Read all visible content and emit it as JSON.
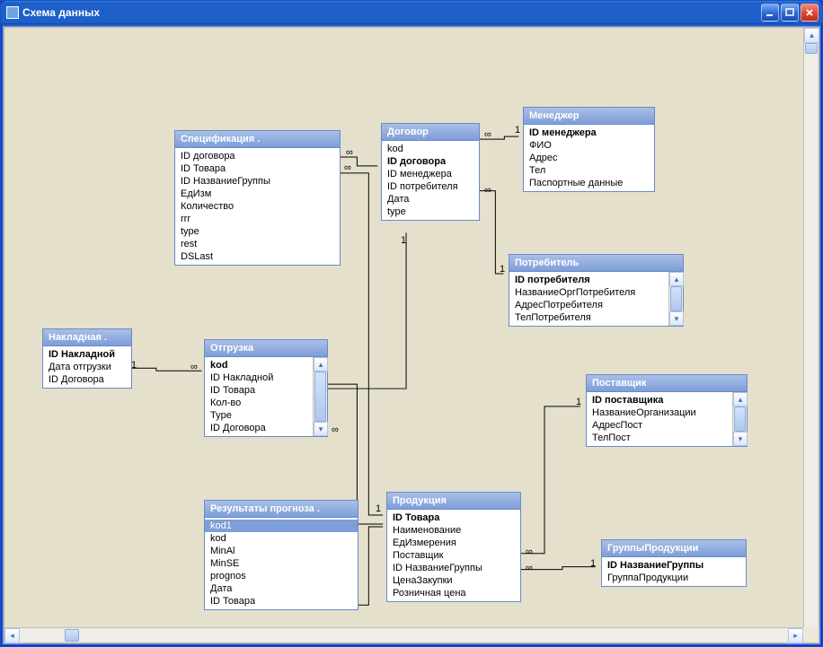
{
  "window": {
    "title": "Схема данных"
  },
  "labels": {
    "one": "1",
    "many": "∞"
  },
  "entities": {
    "specification": {
      "title": "Спецификация .",
      "fields": [
        "ID договора",
        "ID Товара",
        "ID НазваниеГруппы",
        "ЕдИзм",
        "Количество",
        "rrr",
        "type",
        "rest",
        "DSLast"
      ]
    },
    "contract": {
      "title": "Договор",
      "fields": [
        {
          "text": "kod",
          "pk": false
        },
        {
          "text": "ID договора",
          "pk": true
        },
        {
          "text": "ID менеджера",
          "pk": false
        },
        {
          "text": "ID потребителя",
          "pk": false
        },
        {
          "text": "Дата",
          "pk": false
        },
        {
          "text": "type",
          "pk": false
        }
      ]
    },
    "manager": {
      "title": "Менеджер",
      "fields": [
        {
          "text": "ID менеджера",
          "pk": true
        },
        {
          "text": "ФИО"
        },
        {
          "text": "Адрес"
        },
        {
          "text": "Тел"
        },
        {
          "text": "Паспортные данные"
        }
      ]
    },
    "consumer": {
      "title": "Потребитель",
      "fields": [
        {
          "text": "ID потребителя",
          "pk": true
        },
        {
          "text": "НазваниеОргПотребителя"
        },
        {
          "text": "АдресПотребителя"
        },
        {
          "text": "ТелПотребителя"
        }
      ]
    },
    "invoice": {
      "title": "Накладная .",
      "fields": [
        {
          "text": "ID Накладной",
          "pk": true
        },
        {
          "text": "Дата отгрузки"
        },
        {
          "text": "ID Договора"
        }
      ]
    },
    "shipment": {
      "title": "Отгрузка",
      "fields": [
        {
          "text": "kod",
          "pk": true
        },
        {
          "text": "ID Накладной"
        },
        {
          "text": "ID Товара"
        },
        {
          "text": "Кол-во"
        },
        {
          "text": "Type"
        },
        {
          "text": "ID Договора"
        }
      ]
    },
    "forecast": {
      "title": "Результаты прогноза .",
      "fields": [
        {
          "text": "kod1",
          "selected": true
        },
        {
          "text": "kod"
        },
        {
          "text": "MinAl"
        },
        {
          "text": "MinSE"
        },
        {
          "text": "prognos"
        },
        {
          "text": "Дата"
        },
        {
          "text": "ID Товара"
        }
      ]
    },
    "product": {
      "title": "Продукция",
      "fields": [
        {
          "text": "ID Товара",
          "pk": true
        },
        {
          "text": "Наименование"
        },
        {
          "text": "ЕдИзмерения"
        },
        {
          "text": "Поставщик"
        },
        {
          "text": "ID НазваниеГруппы"
        },
        {
          "text": "ЦенаЗакупки"
        },
        {
          "text": "Розничная цена"
        }
      ]
    },
    "supplier": {
      "title": "Поставщик",
      "fields": [
        {
          "text": "ID поставщика",
          "pk": true
        },
        {
          "text": "НазваниеОрганизации"
        },
        {
          "text": "АдресПост"
        },
        {
          "text": "ТелПост"
        }
      ]
    },
    "productgroup": {
      "title": "ГруппыПродукции",
      "fields": [
        {
          "text": "ID НазваниеГруппы",
          "pk": true
        },
        {
          "text": "ГруппаПродукции"
        }
      ]
    }
  }
}
